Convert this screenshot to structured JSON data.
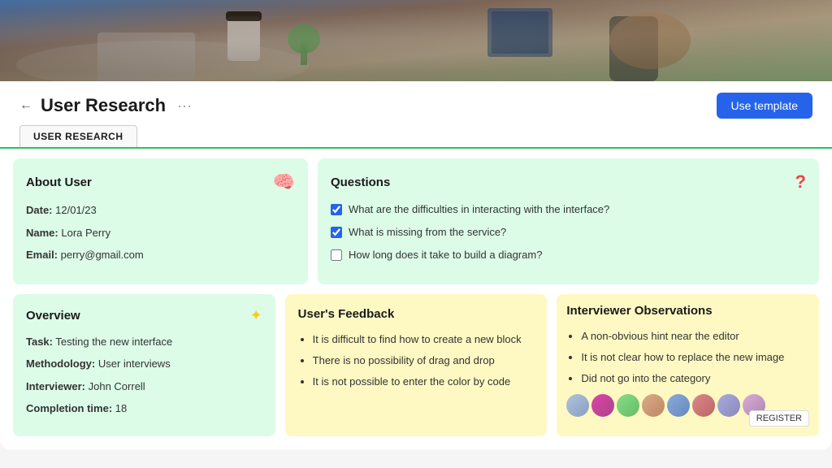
{
  "hero": {
    "alt": "Hero background image showing workspace"
  },
  "header": {
    "back_label": "←",
    "title": "User Research",
    "more_label": "···",
    "use_template_label": "Use template"
  },
  "tabs": [
    {
      "label": "USER RESEARCH",
      "active": true
    }
  ],
  "about_user": {
    "title": "About User",
    "icon": "🧠",
    "date_label": "Date:",
    "date_value": "12/01/23",
    "name_label": "Name:",
    "name_value": "Lora Perry",
    "email_label": "Email:",
    "email_value": "perry@gmail.com"
  },
  "questions": {
    "title": "Questions",
    "icon": "?",
    "items": [
      {
        "text": "What are the difficulties in interacting with the interface?",
        "checked": true
      },
      {
        "text": "What is missing from the service?",
        "checked": true
      },
      {
        "text": "How long does it take to build a diagram?",
        "checked": false
      }
    ]
  },
  "overview": {
    "title": "Overview",
    "icon": "✦",
    "task_label": "Task:",
    "task_value": "Testing the new interface",
    "methodology_label": "Methodology:",
    "methodology_value": "User interviews",
    "interviewer_label": "Interviewer:",
    "interviewer_value": "John Correll",
    "completion_label": "Completion time:",
    "completion_value": "18"
  },
  "users_feedback": {
    "title": "User's Feedback",
    "items": [
      "It is difficult to find how to create a new block",
      "There is no possibility of drag and drop",
      "It is not possible to enter the color by code"
    ]
  },
  "interviewer_observations": {
    "title": "Interviewer Observations",
    "items": [
      "A non-obvious hint near the editor",
      "It is not clear how to replace the new image",
      "Did not go into the category"
    ]
  },
  "register": {
    "label": "REGISTER"
  }
}
